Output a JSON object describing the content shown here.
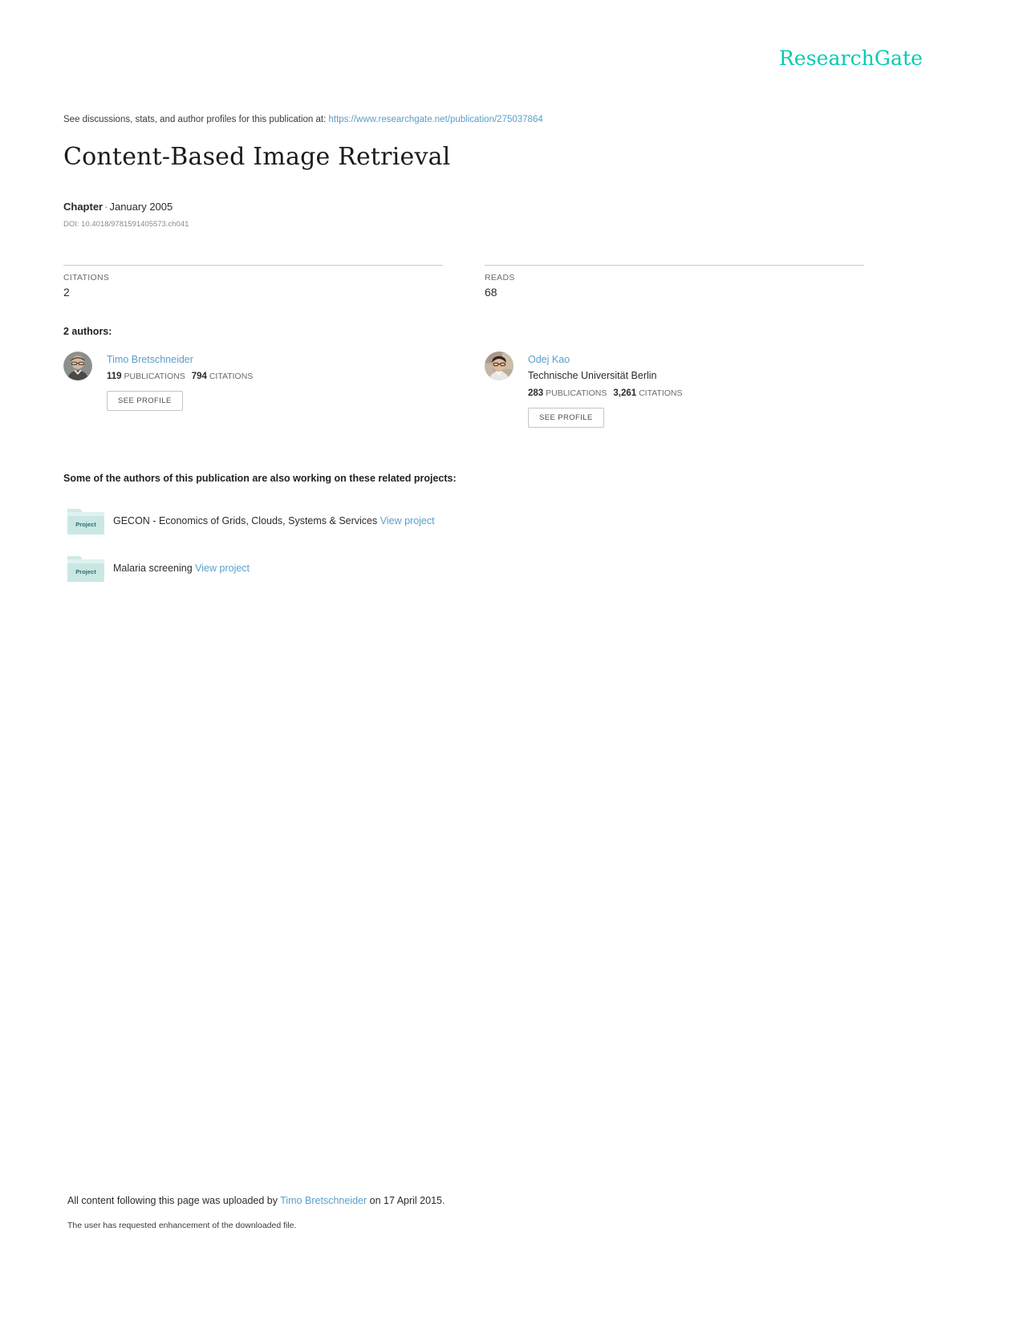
{
  "brand": {
    "name": "ResearchGate",
    "color": "#00ccb1"
  },
  "header": {
    "discussion_prefix": "See discussions, stats, and author profiles for this publication at:",
    "publication_url": "https://www.researchgate.net/publication/275037864"
  },
  "publication": {
    "title": "Content-Based Image Retrieval",
    "type": "Chapter",
    "separator": "·",
    "date": "January 2005",
    "doi": "DOI: 10.4018/9781591405573.ch041"
  },
  "stats": [
    {
      "label": "CITATIONS",
      "value": "2"
    },
    {
      "label": "READS",
      "value": "68"
    }
  ],
  "authors_section": {
    "heading": "2 authors:",
    "see_profile_label": "SEE PROFILE",
    "publications_label": "PUBLICATIONS",
    "citations_label": "CITATIONS",
    "authors": [
      {
        "name": "Timo Bretschneider",
        "affiliation": "",
        "publications": "119",
        "citations": "794",
        "avatar_name": "author-avatar-timo-bretschneider"
      },
      {
        "name": "Odej Kao",
        "affiliation": "Technische Universität Berlin",
        "publications": "283",
        "citations": "3,261",
        "avatar_name": "author-avatar-odej-kao"
      }
    ]
  },
  "projects_section": {
    "heading": "Some of the authors of this publication are also working on these related projects:",
    "folder_icon_label": "Project",
    "view_project_label": "View project",
    "projects": [
      {
        "title": "GECON - Economics of Grids, Clouds, Systems & Services"
      },
      {
        "title": "Malaria screening"
      }
    ]
  },
  "footer": {
    "upload_prefix": "All content following this page was uploaded by",
    "uploader": "Timo Bretschneider",
    "upload_suffix": "on 17 April 2015.",
    "note": "The user has requested enhancement of the downloaded file."
  }
}
